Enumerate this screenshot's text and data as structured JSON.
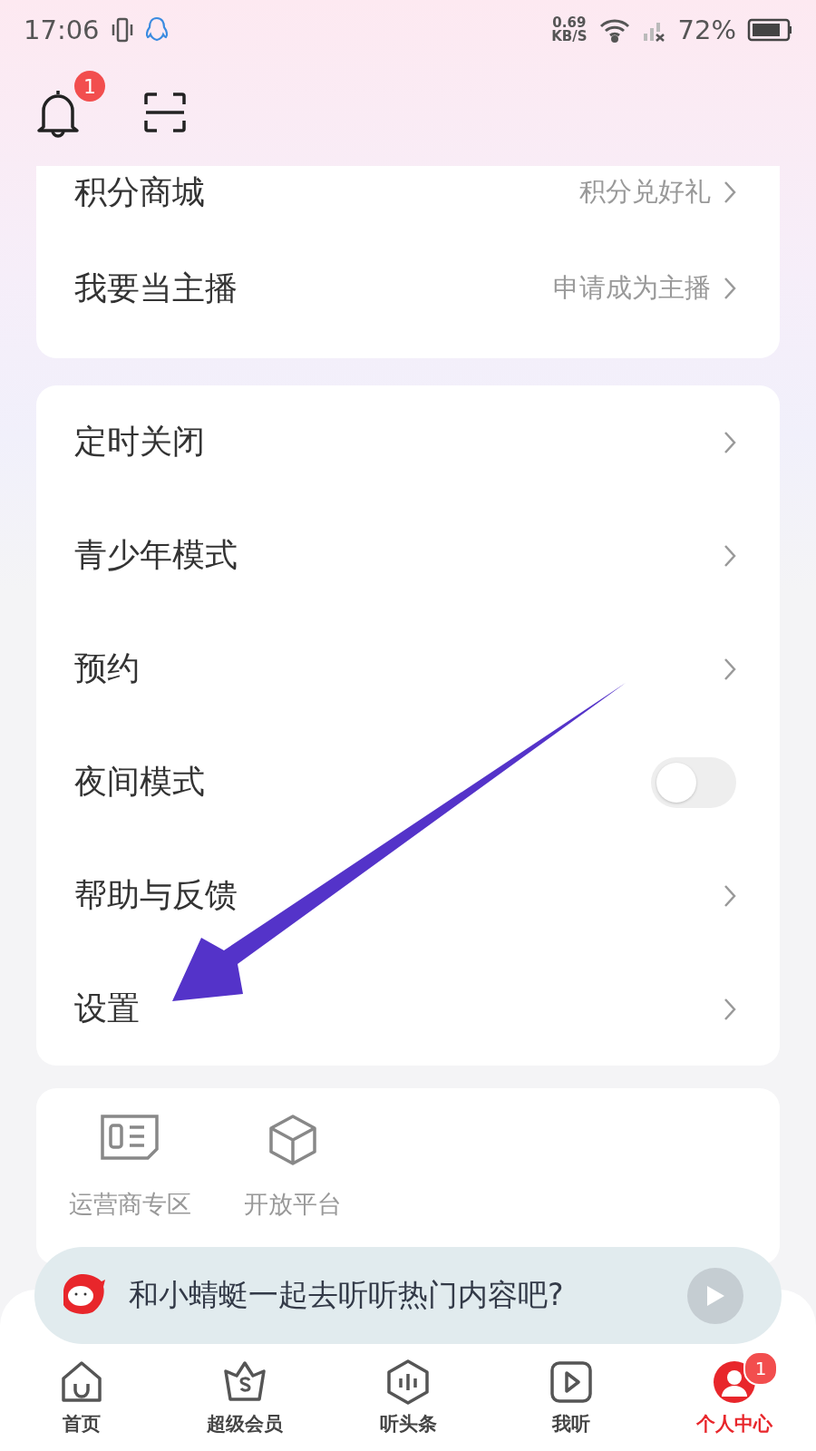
{
  "status_bar": {
    "time": "17:06",
    "speed": "0.69",
    "speed_unit": "KB/S",
    "battery": "72%"
  },
  "header": {
    "notification_badge": "1"
  },
  "card_top": [
    {
      "label": "积分商城",
      "hint": "积分兑好礼",
      "kind": "link"
    },
    {
      "label": "我要当主播",
      "hint": "申请成为主播",
      "kind": "link"
    }
  ],
  "settings_card": [
    {
      "label": "定时关闭",
      "kind": "link"
    },
    {
      "label": "青少年模式",
      "kind": "link"
    },
    {
      "label": "预约",
      "kind": "link"
    },
    {
      "label": "夜间模式",
      "kind": "toggle",
      "on": false
    },
    {
      "label": "帮助与反馈",
      "kind": "link"
    },
    {
      "label": "设置",
      "kind": "link"
    }
  ],
  "tools": [
    {
      "label": "运营商专区",
      "kind": "sim"
    },
    {
      "label": "开放平台",
      "kind": "cube"
    }
  ],
  "banner": {
    "text": "和小蜻蜓一起去听听热门内容吧?"
  },
  "tab_bar": [
    {
      "label": "首页",
      "kind": "home",
      "selected": false
    },
    {
      "label": "超级会员",
      "kind": "vip",
      "selected": false
    },
    {
      "label": "听头条",
      "kind": "news",
      "selected": false
    },
    {
      "label": "我听",
      "kind": "play",
      "selected": false
    },
    {
      "label": "个人中心",
      "kind": "me",
      "selected": true,
      "badge": "1"
    }
  ],
  "annotation": {
    "kind": "arrow"
  }
}
